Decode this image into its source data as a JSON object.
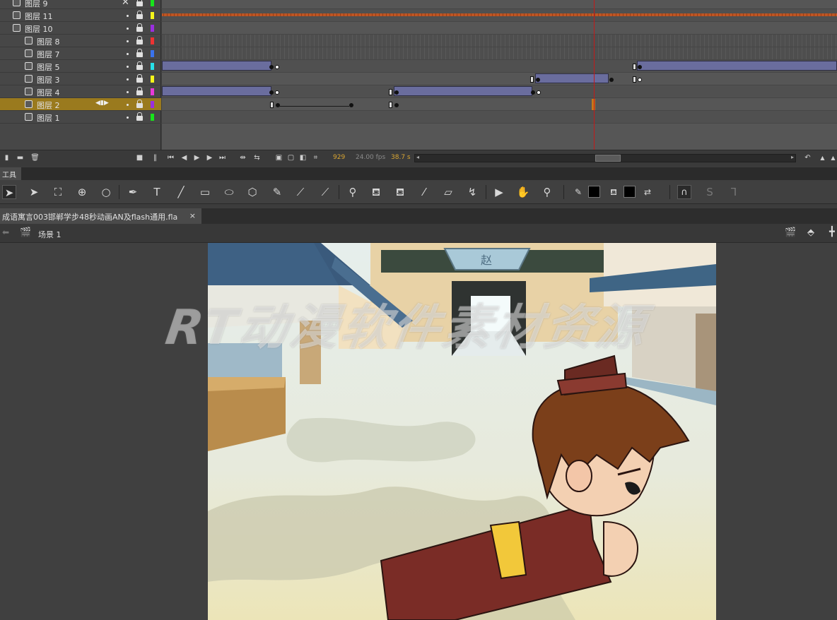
{
  "timeline": {
    "layers": [
      {
        "name": "图层 9",
        "type": "guide",
        "color": "#17e41b"
      },
      {
        "name": "图层 11",
        "type": "normal",
        "color": "#f5f51a"
      },
      {
        "name": "图层 10",
        "type": "mask",
        "color": "#9a2ee0"
      },
      {
        "name": "图层 8",
        "type": "masked",
        "color": "#ee3333"
      },
      {
        "name": "图层 7",
        "type": "masked",
        "color": "#3a73ee"
      },
      {
        "name": "图层 5",
        "type": "masked",
        "color": "#27e0e8"
      },
      {
        "name": "图层 3",
        "type": "masked",
        "color": "#f5f51a"
      },
      {
        "name": "图层 4",
        "type": "masked",
        "color": "#e83ad8"
      },
      {
        "name": "图层 2",
        "type": "masked",
        "color": "#9a2ee0",
        "selected": true
      },
      {
        "name": "图层 1",
        "type": "masked",
        "color": "#17e41b"
      }
    ],
    "current_frame": "929",
    "fps": "24.00 fps",
    "time": "38.7 s"
  },
  "tools": {
    "panel_title": "工具",
    "items": [
      "selection-tool",
      "subselection-tool",
      "free-transform-tool",
      "3d-rotation-tool",
      "lasso-tool",
      "pen-tool",
      "text-tool",
      "line-tool",
      "rectangle-tool",
      "oval-tool",
      "polystar-tool",
      "pencil-tool",
      "paint-brush-tool",
      "brush-tool",
      "bone-tool",
      "paint-bucket-tool",
      "ink-bottle-tool",
      "eyedropper-tool",
      "eraser-tool",
      "width-tool",
      "camera-tool",
      "hand-tool",
      "zoom-tool"
    ],
    "stroke_color": "#000000",
    "fill_color": "#000000"
  },
  "document": {
    "tab_title": "成语寓言003邯郸学步48秒动画AN及flash通用.fla",
    "scene_label": "场景 1"
  },
  "stage": {
    "gate_sign": "赵",
    "watermark": "RT动漫软件素材资源"
  }
}
